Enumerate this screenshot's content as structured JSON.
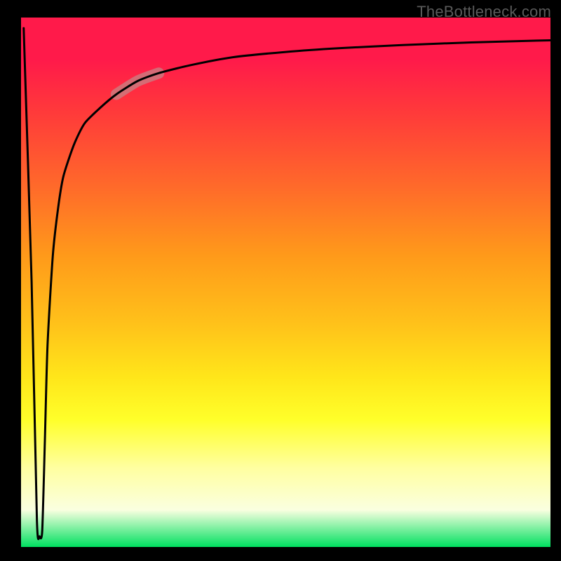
{
  "attribution": "TheBottleneck.com",
  "chart_data": {
    "type": "line",
    "title": "",
    "xlabel": "",
    "ylabel": "",
    "xlim": [
      0,
      100
    ],
    "ylim": [
      0,
      100
    ],
    "gradient_stops": [
      {
        "pos": 0,
        "color": "#ff1a4a"
      },
      {
        "pos": 0.08,
        "color": "#ff1a4a"
      },
      {
        "pos": 0.18,
        "color": "#ff3a3a"
      },
      {
        "pos": 0.32,
        "color": "#ff6a2a"
      },
      {
        "pos": 0.45,
        "color": "#ff9a1a"
      },
      {
        "pos": 0.58,
        "color": "#ffc21a"
      },
      {
        "pos": 0.68,
        "color": "#ffe61a"
      },
      {
        "pos": 0.76,
        "color": "#ffff2a"
      },
      {
        "pos": 0.85,
        "color": "#ffffa0"
      },
      {
        "pos": 0.93,
        "color": "#faffe0"
      },
      {
        "pos": 1.0,
        "color": "#00e060"
      }
    ],
    "series": [
      {
        "name": "curve",
        "x": [
          0.5,
          2.0,
          3.0,
          3.5,
          4.0,
          4.5,
          5.0,
          6.0,
          7.0,
          8.0,
          10.0,
          12.0,
          15.0,
          18.0,
          22.0,
          26.0,
          32.0,
          40.0,
          50.0,
          60.0,
          72.0,
          85.0,
          100.0
        ],
        "values": [
          98,
          50,
          5,
          2,
          3,
          20,
          38,
          55,
          64,
          70,
          76,
          80,
          83,
          85.5,
          88,
          89.5,
          91,
          92.5,
          93.5,
          94.2,
          94.8,
          95.3,
          95.7
        ]
      }
    ],
    "highlight_segment": {
      "x_range": [
        18,
        26
      ],
      "color": "#c28a8a",
      "opacity": 0.7
    }
  }
}
